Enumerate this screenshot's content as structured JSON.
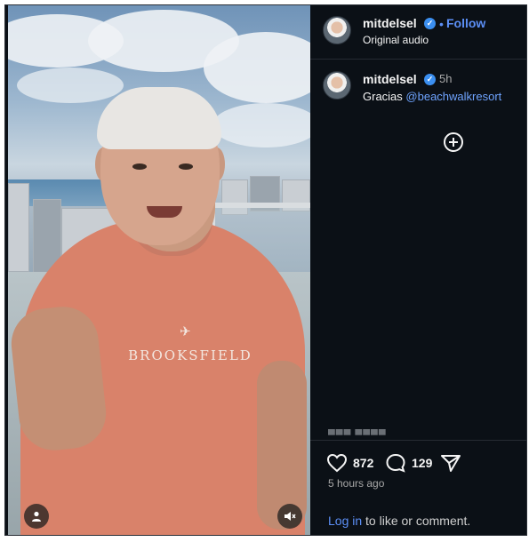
{
  "header": {
    "username": "mitdelsel",
    "separator": "•",
    "follow_label": "Follow",
    "audio_label": "Original audio"
  },
  "post": {
    "username": "mitdelsel",
    "time": "5h",
    "caption_prefix": "Gracias ",
    "mention": "@beachwalkresort"
  },
  "video": {
    "shirt_text": "BROOKSFIELD"
  },
  "actions": {
    "likes": "872",
    "comments": "129"
  },
  "meta": {
    "posted_ago": "5 hours ago",
    "login_link": "Log in",
    "login_suffix": " to like or comment."
  },
  "icons": {
    "verified": "verified-badge-icon",
    "add": "add-circle-icon",
    "like": "heart-icon",
    "comment": "comment-bubble-icon",
    "share": "share-plane-icon",
    "user": "user-icon",
    "mute": "muted-speaker-icon"
  },
  "colors": {
    "accent": "#5c8ff6",
    "mention": "#6fa4ff",
    "verified": "#3b8ff0",
    "panel_bg": "#0b1016",
    "shirt": "#d9826a"
  }
}
